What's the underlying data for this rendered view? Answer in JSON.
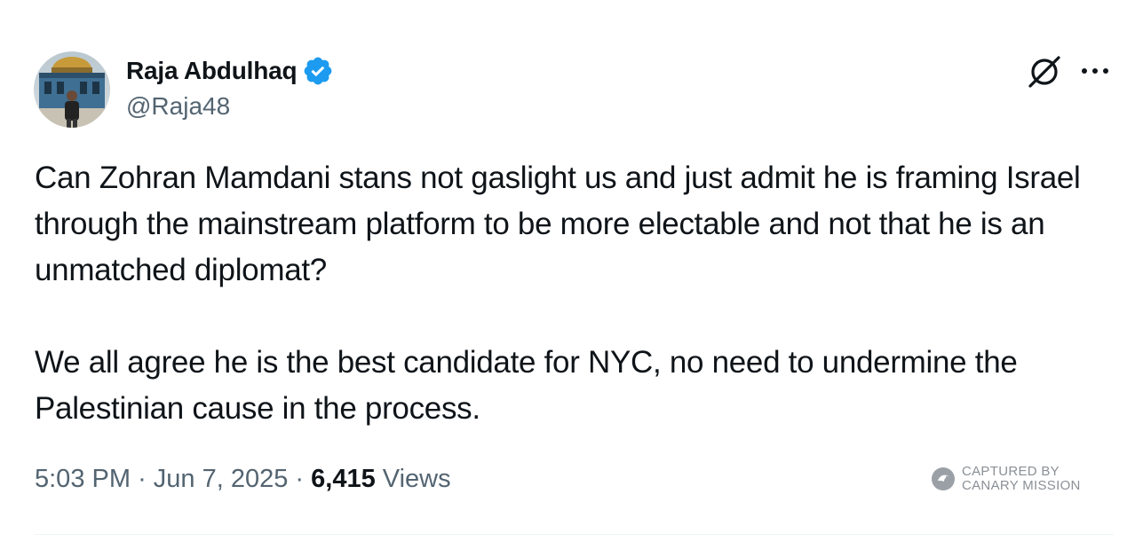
{
  "author": {
    "display_name": "Raja Abdulhaq",
    "handle": "@Raja48",
    "verified": true,
    "verified_color": "#1d9bf0"
  },
  "header_icons": {
    "grok": "grok-icon",
    "more": "more-icon"
  },
  "tweet": {
    "paragraphs": [
      "Can Zohran Mamdani stans not gaslight us and just admit he is framing Israel through the mainstream platform to be more electable and not that he is an unmatched diplomat?",
      "We all agree he is the best candidate for NYC, no need to undermine the Palestinian cause in the process."
    ]
  },
  "meta": {
    "time": "5:03 PM",
    "separator": "·",
    "date": "Jun 7, 2025",
    "views_count": "6,415",
    "views_label": "Views"
  },
  "watermark": {
    "line1": "CAPTURED BY",
    "line2": "CANARY MISSION",
    "icon": "canary-logo"
  },
  "colors": {
    "text_primary": "#0f1419",
    "text_secondary": "#536471",
    "accent": "#1d9bf0",
    "divider": "#eff3f4"
  }
}
